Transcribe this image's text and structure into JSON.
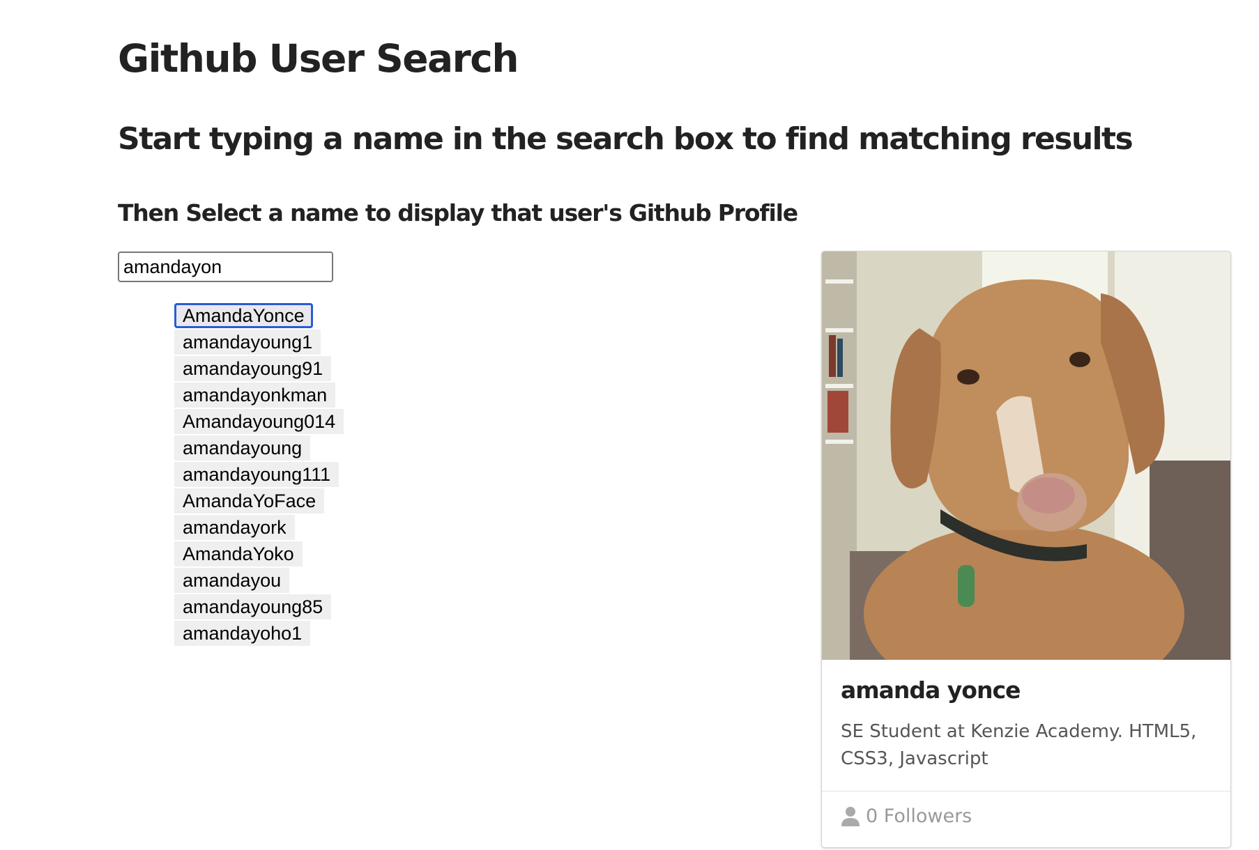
{
  "page": {
    "title": "Github User Search",
    "subtitle": "Start typing a name in the search box to find matching results",
    "instruction": "Then Select a name to display that user's Github Profile"
  },
  "search": {
    "value": "amandayon"
  },
  "results": [
    "AmandaYonce",
    "amandayoung1",
    "amandayoung91",
    "amandayonkman",
    "Amandayoung014",
    "amandayoung",
    "amandayoung111",
    "AmandaYoFace",
    "amandayork",
    "AmandaYoko",
    "amandayou",
    "amandayoung85",
    "amandayoho1"
  ],
  "profile": {
    "name": "amanda yonce",
    "bio": "SE Student at Kenzie Academy. HTML5, CSS3, Javascript",
    "followers": "0 Followers",
    "avatar_icon": "user-icon",
    "photo_subject": "dog photo"
  },
  "colors": {
    "focus_ring": "#2a5bd7",
    "result_bg": "#efefef",
    "muted_text": "#999999"
  }
}
